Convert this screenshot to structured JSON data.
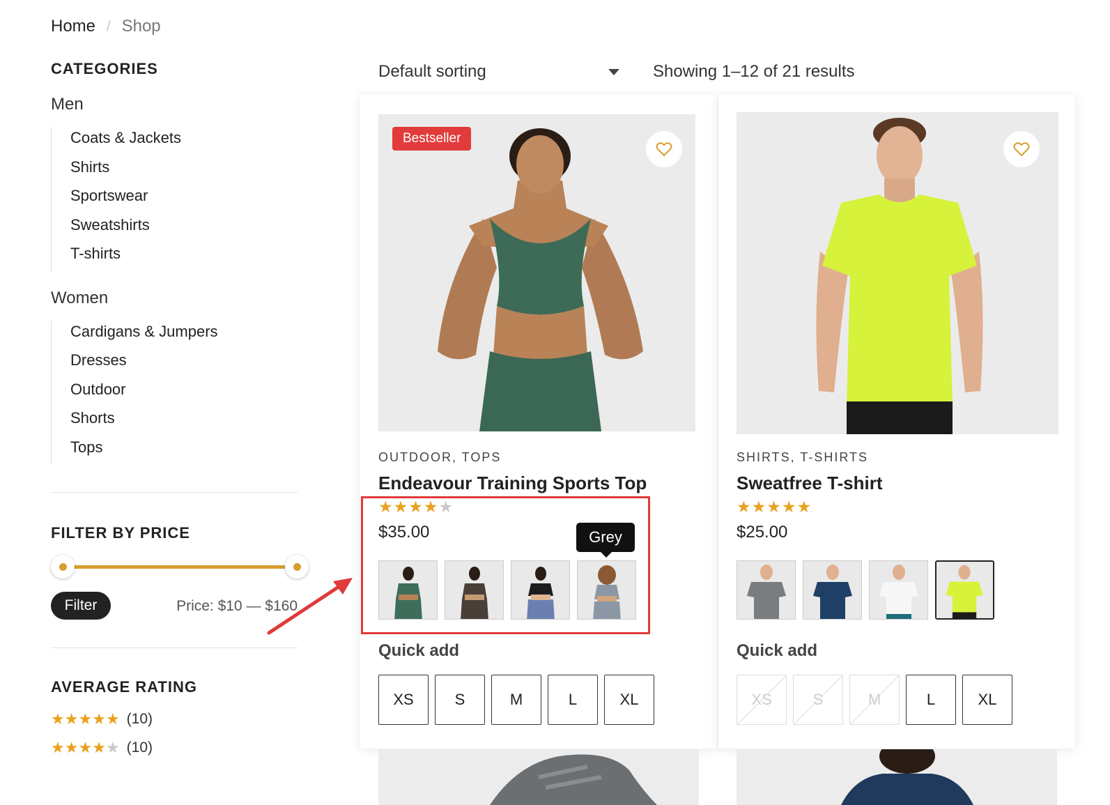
{
  "breadcrumb": {
    "home": "Home",
    "separator": "/",
    "current": "Shop"
  },
  "sidebar": {
    "categories_title": "CATEGORIES",
    "groups": [
      {
        "label": "Men",
        "items": [
          "Coats & Jackets",
          "Shirts",
          "Sportswear",
          "Sweatshirts",
          "T-shirts"
        ]
      },
      {
        "label": "Women",
        "items": [
          "Cardigans & Jumpers",
          "Dresses",
          "Outdoor",
          "Shorts",
          "Tops"
        ]
      }
    ],
    "price_filter": {
      "title": "FILTER BY PRICE",
      "button": "Filter",
      "label": "Price: $10 — $160",
      "min": 10,
      "max": 160
    },
    "average_rating": {
      "title": "AVERAGE RATING",
      "rows": [
        {
          "stars": 5,
          "count": "(10)"
        },
        {
          "stars": 4,
          "count": "(10)"
        }
      ]
    }
  },
  "toolbar": {
    "sorting": "Default sorting",
    "result_count": "Showing 1–12 of 21 results"
  },
  "products": [
    {
      "badge": "Bestseller",
      "categories": "OUTDOOR, TOPS",
      "title": "Endeavour Training Sports Top",
      "rating": 4,
      "price": "$35.00",
      "tooltip": "Grey",
      "quick_add": "Quick add",
      "swatches": [
        {
          "color": "#3e6e5a",
          "selected": false
        },
        {
          "color": "#4a3f38",
          "selected": false
        },
        {
          "color": "#1d1d1f",
          "selected": false
        },
        {
          "color": "#8c97a6",
          "selected": false
        }
      ],
      "sizes": [
        {
          "label": "XS",
          "available": true
        },
        {
          "label": "S",
          "available": true
        },
        {
          "label": "M",
          "available": true
        },
        {
          "label": "L",
          "available": true
        },
        {
          "label": "XL",
          "available": true
        }
      ]
    },
    {
      "categories": "SHIRTS, T-SHIRTS",
      "title": "Sweatfree T-shirt",
      "rating": 5,
      "price": "$25.00",
      "quick_add": "Quick add",
      "swatches": [
        {
          "color": "#7a7d80",
          "selected": false
        },
        {
          "color": "#1f3f66",
          "selected": false
        },
        {
          "color": "#f2f2f2",
          "selected": false
        },
        {
          "color": "#d8f23a",
          "selected": true
        }
      ],
      "sizes": [
        {
          "label": "XS",
          "available": false
        },
        {
          "label": "S",
          "available": false
        },
        {
          "label": "M",
          "available": false
        },
        {
          "label": "L",
          "available": true
        },
        {
          "label": "XL",
          "available": true
        }
      ]
    }
  ],
  "colors": {
    "accent": "#d79f30",
    "star": "#e9a11e",
    "badge": "#e23b3b",
    "highlight": "#e03a3a"
  }
}
